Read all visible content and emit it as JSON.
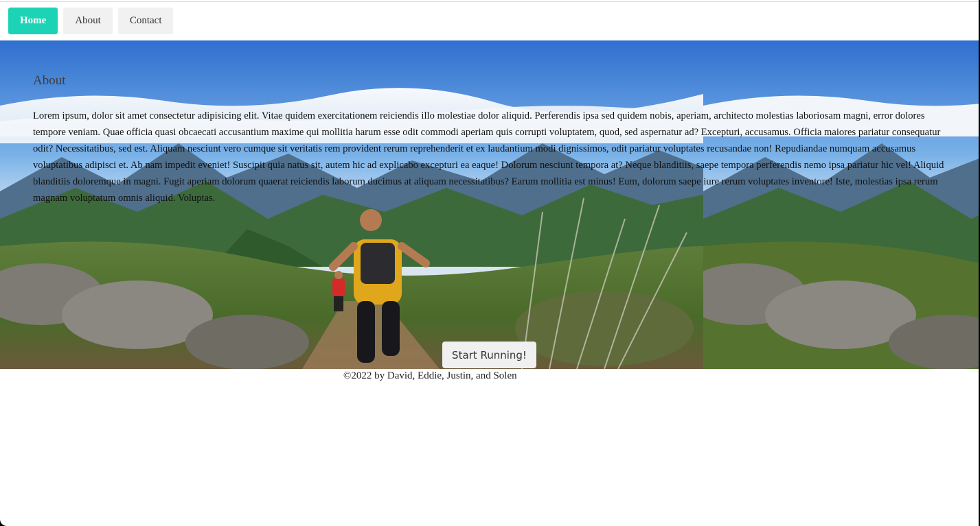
{
  "nav": {
    "items": [
      {
        "label": "Home",
        "active": true
      },
      {
        "label": "About",
        "active": false
      },
      {
        "label": "Contact",
        "active": false
      }
    ]
  },
  "about": {
    "title": "About",
    "body": "Lorem ipsum, dolor sit amet consectetur adipisicing elit. Vitae quidem exercitationem reiciendis illo molestiae dolor aliquid. Perferendis ipsa sed quidem nobis, aperiam, architecto molestias laboriosam magni, error dolores tempore veniam. Quae officia quasi obcaecati accusantium maxime qui mollitia harum esse odit commodi aperiam quis corrupti voluptatem, quod, sed aspernatur ad? Excepturi, accusamus. Officia maiores pariatur consequatur odit? Necessitatibus, sed est. Aliquam nesciunt vero cumque sit veritatis rem provident rerum reprehenderit et ex laudantium modi dignissimos, odit pariatur voluptates recusandae non! Repudiandae numquam accusamus voluptatibus adipisci et. Ab nam impedit eveniet! Suscipit quia natus sit, autem hic ad explicabo excepturi ea eaque! Dolorum nesciunt tempora at? Neque blanditiis, saepe tempora perferendis nemo ipsa pariatur hic vel! Aliquid blanditiis doloremque in magni. Fugit aperiam dolorum quaerat reiciendis laborum ducimus at aliquam necessitatibus? Earum mollitia est minus! Eum, dolorum saepe iure rerum voluptates inventore! Iste, molestias ipsa rerum magnam voluptatum omnis aliquid. Voluptas."
  },
  "hero": {
    "button_label": "Start Running!"
  },
  "footer": {
    "text": "©2022 by David, Eddie, Justin, and Solen"
  },
  "colors": {
    "accent": "#1cd4b5",
    "button_bg": "#f1f1f1",
    "sky": "#4a8fdc"
  }
}
